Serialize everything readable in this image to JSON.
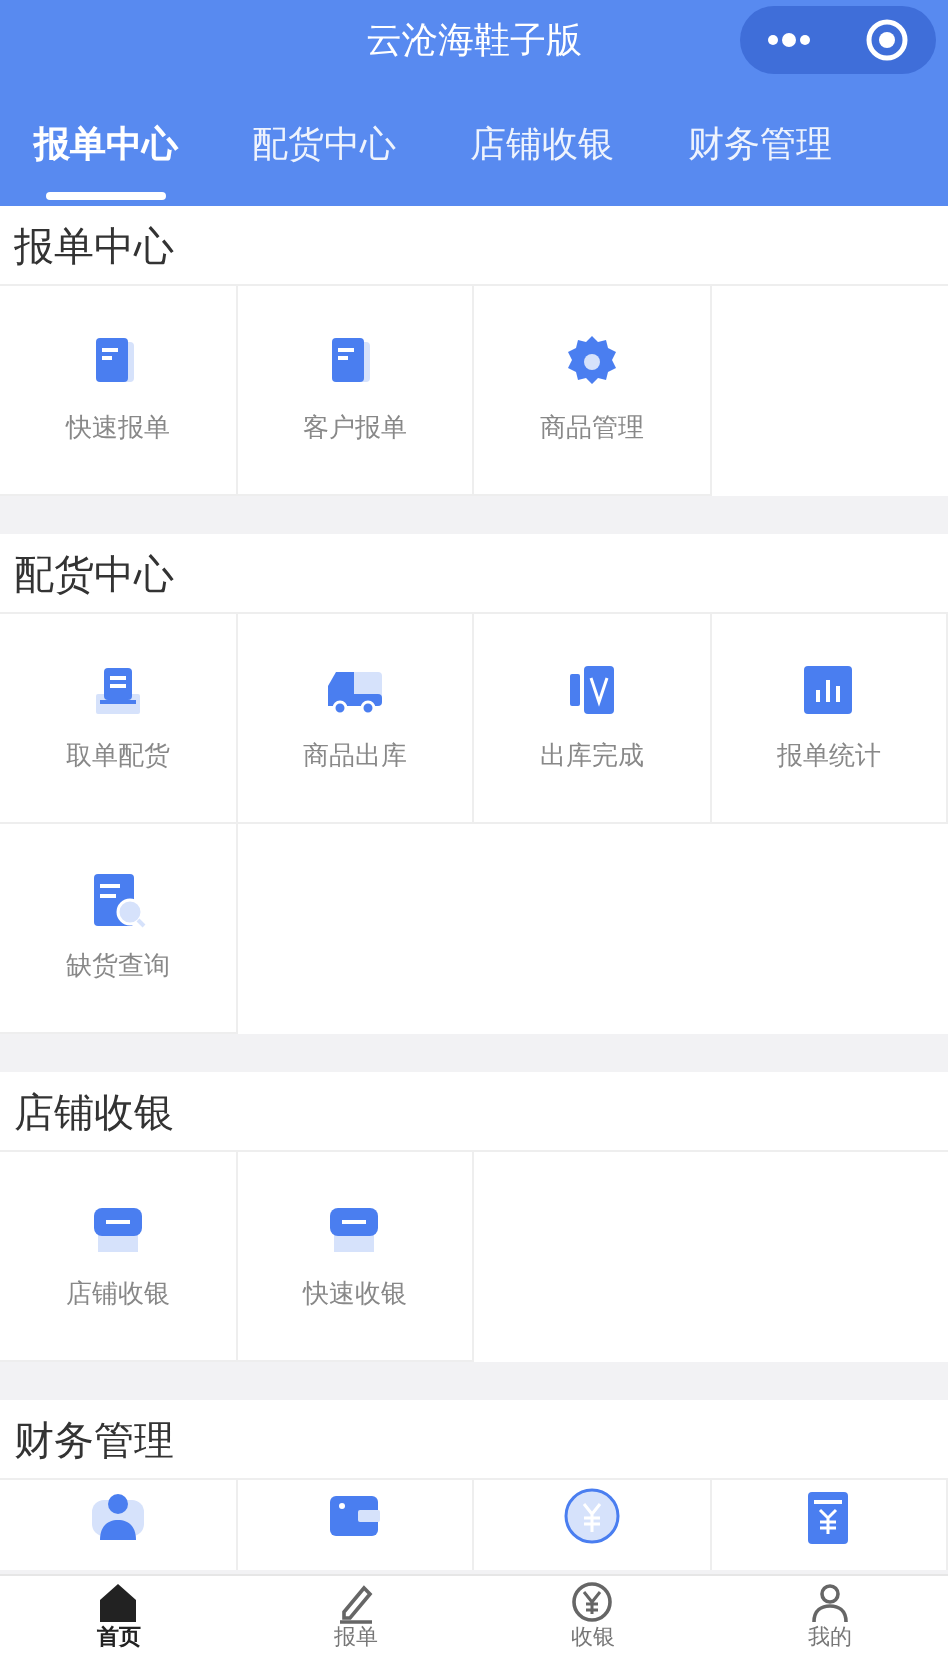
{
  "window": {
    "title": "云沧海鞋子版"
  },
  "tabs": [
    {
      "label": "报单中心",
      "selected": true
    },
    {
      "label": "配货中心",
      "selected": false
    },
    {
      "label": "店铺收银",
      "selected": false
    },
    {
      "label": "财务管理",
      "selected": false
    }
  ],
  "sections": [
    {
      "title": "报单中心",
      "items": [
        {
          "kind": "doc",
          "label": "快速报单"
        },
        {
          "kind": "doc",
          "label": "客户报单"
        },
        {
          "kind": "gear",
          "label": "商品管理"
        }
      ]
    },
    {
      "title": "配货中心",
      "items": [
        {
          "kind": "tray",
          "label": "取单配货"
        },
        {
          "kind": "truck",
          "label": "商品出库"
        },
        {
          "kind": "card",
          "label": "出库完成"
        },
        {
          "kind": "chart",
          "label": "报单统计"
        },
        {
          "kind": "finddoc",
          "label": "缺货查询"
        }
      ]
    },
    {
      "title": "店铺收银",
      "items": [
        {
          "kind": "register",
          "label": "店铺收银"
        },
        {
          "kind": "register",
          "label": "快速收银"
        }
      ]
    },
    {
      "title": "财务管理",
      "items": [
        {
          "kind": "person"
        },
        {
          "kind": "wallet"
        },
        {
          "kind": "coin"
        },
        {
          "kind": "receipt"
        }
      ]
    }
  ],
  "bottom_nav": [
    {
      "kind": "home",
      "label": "首页",
      "selected": true
    },
    {
      "kind": "pen",
      "label": "报单",
      "selected": false
    },
    {
      "kind": "cash",
      "label": "收银",
      "selected": false
    },
    {
      "kind": "me",
      "label": "我的",
      "selected": false
    }
  ]
}
